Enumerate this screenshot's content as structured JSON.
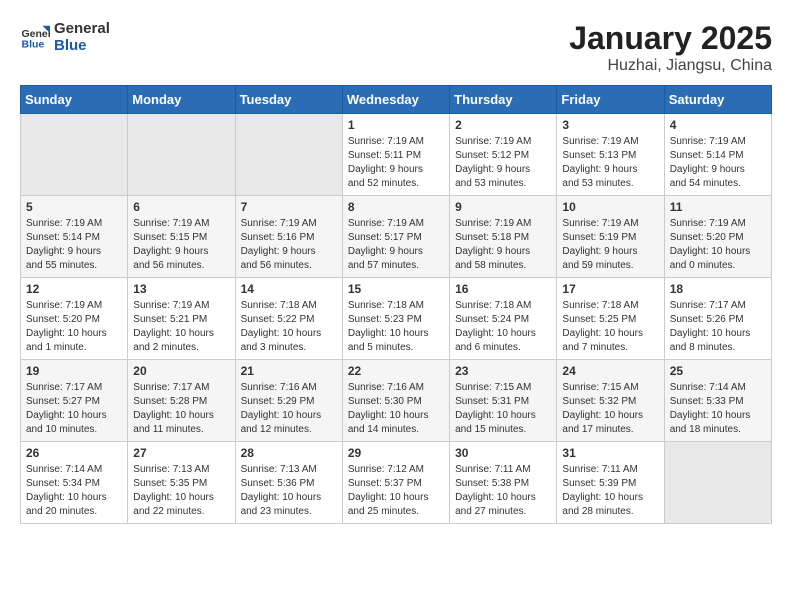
{
  "header": {
    "logo_line1": "General",
    "logo_line2": "Blue",
    "title": "January 2025",
    "subtitle": "Huzhai, Jiangsu, China"
  },
  "days_of_week": [
    "Sunday",
    "Monday",
    "Tuesday",
    "Wednesday",
    "Thursday",
    "Friday",
    "Saturday"
  ],
  "weeks": [
    [
      {
        "day": "",
        "info": ""
      },
      {
        "day": "",
        "info": ""
      },
      {
        "day": "",
        "info": ""
      },
      {
        "day": "1",
        "info": "Sunrise: 7:19 AM\nSunset: 5:11 PM\nDaylight: 9 hours\nand 52 minutes."
      },
      {
        "day": "2",
        "info": "Sunrise: 7:19 AM\nSunset: 5:12 PM\nDaylight: 9 hours\nand 53 minutes."
      },
      {
        "day": "3",
        "info": "Sunrise: 7:19 AM\nSunset: 5:13 PM\nDaylight: 9 hours\nand 53 minutes."
      },
      {
        "day": "4",
        "info": "Sunrise: 7:19 AM\nSunset: 5:14 PM\nDaylight: 9 hours\nand 54 minutes."
      }
    ],
    [
      {
        "day": "5",
        "info": "Sunrise: 7:19 AM\nSunset: 5:14 PM\nDaylight: 9 hours\nand 55 minutes."
      },
      {
        "day": "6",
        "info": "Sunrise: 7:19 AM\nSunset: 5:15 PM\nDaylight: 9 hours\nand 56 minutes."
      },
      {
        "day": "7",
        "info": "Sunrise: 7:19 AM\nSunset: 5:16 PM\nDaylight: 9 hours\nand 56 minutes."
      },
      {
        "day": "8",
        "info": "Sunrise: 7:19 AM\nSunset: 5:17 PM\nDaylight: 9 hours\nand 57 minutes."
      },
      {
        "day": "9",
        "info": "Sunrise: 7:19 AM\nSunset: 5:18 PM\nDaylight: 9 hours\nand 58 minutes."
      },
      {
        "day": "10",
        "info": "Sunrise: 7:19 AM\nSunset: 5:19 PM\nDaylight: 9 hours\nand 59 minutes."
      },
      {
        "day": "11",
        "info": "Sunrise: 7:19 AM\nSunset: 5:20 PM\nDaylight: 10 hours\nand 0 minutes."
      }
    ],
    [
      {
        "day": "12",
        "info": "Sunrise: 7:19 AM\nSunset: 5:20 PM\nDaylight: 10 hours\nand 1 minute."
      },
      {
        "day": "13",
        "info": "Sunrise: 7:19 AM\nSunset: 5:21 PM\nDaylight: 10 hours\nand 2 minutes."
      },
      {
        "day": "14",
        "info": "Sunrise: 7:18 AM\nSunset: 5:22 PM\nDaylight: 10 hours\nand 3 minutes."
      },
      {
        "day": "15",
        "info": "Sunrise: 7:18 AM\nSunset: 5:23 PM\nDaylight: 10 hours\nand 5 minutes."
      },
      {
        "day": "16",
        "info": "Sunrise: 7:18 AM\nSunset: 5:24 PM\nDaylight: 10 hours\nand 6 minutes."
      },
      {
        "day": "17",
        "info": "Sunrise: 7:18 AM\nSunset: 5:25 PM\nDaylight: 10 hours\nand 7 minutes."
      },
      {
        "day": "18",
        "info": "Sunrise: 7:17 AM\nSunset: 5:26 PM\nDaylight: 10 hours\nand 8 minutes."
      }
    ],
    [
      {
        "day": "19",
        "info": "Sunrise: 7:17 AM\nSunset: 5:27 PM\nDaylight: 10 hours\nand 10 minutes."
      },
      {
        "day": "20",
        "info": "Sunrise: 7:17 AM\nSunset: 5:28 PM\nDaylight: 10 hours\nand 11 minutes."
      },
      {
        "day": "21",
        "info": "Sunrise: 7:16 AM\nSunset: 5:29 PM\nDaylight: 10 hours\nand 12 minutes."
      },
      {
        "day": "22",
        "info": "Sunrise: 7:16 AM\nSunset: 5:30 PM\nDaylight: 10 hours\nand 14 minutes."
      },
      {
        "day": "23",
        "info": "Sunrise: 7:15 AM\nSunset: 5:31 PM\nDaylight: 10 hours\nand 15 minutes."
      },
      {
        "day": "24",
        "info": "Sunrise: 7:15 AM\nSunset: 5:32 PM\nDaylight: 10 hours\nand 17 minutes."
      },
      {
        "day": "25",
        "info": "Sunrise: 7:14 AM\nSunset: 5:33 PM\nDaylight: 10 hours\nand 18 minutes."
      }
    ],
    [
      {
        "day": "26",
        "info": "Sunrise: 7:14 AM\nSunset: 5:34 PM\nDaylight: 10 hours\nand 20 minutes."
      },
      {
        "day": "27",
        "info": "Sunrise: 7:13 AM\nSunset: 5:35 PM\nDaylight: 10 hours\nand 22 minutes."
      },
      {
        "day": "28",
        "info": "Sunrise: 7:13 AM\nSunset: 5:36 PM\nDaylight: 10 hours\nand 23 minutes."
      },
      {
        "day": "29",
        "info": "Sunrise: 7:12 AM\nSunset: 5:37 PM\nDaylight: 10 hours\nand 25 minutes."
      },
      {
        "day": "30",
        "info": "Sunrise: 7:11 AM\nSunset: 5:38 PM\nDaylight: 10 hours\nand 27 minutes."
      },
      {
        "day": "31",
        "info": "Sunrise: 7:11 AM\nSunset: 5:39 PM\nDaylight: 10 hours\nand 28 minutes."
      },
      {
        "day": "",
        "info": ""
      }
    ]
  ]
}
